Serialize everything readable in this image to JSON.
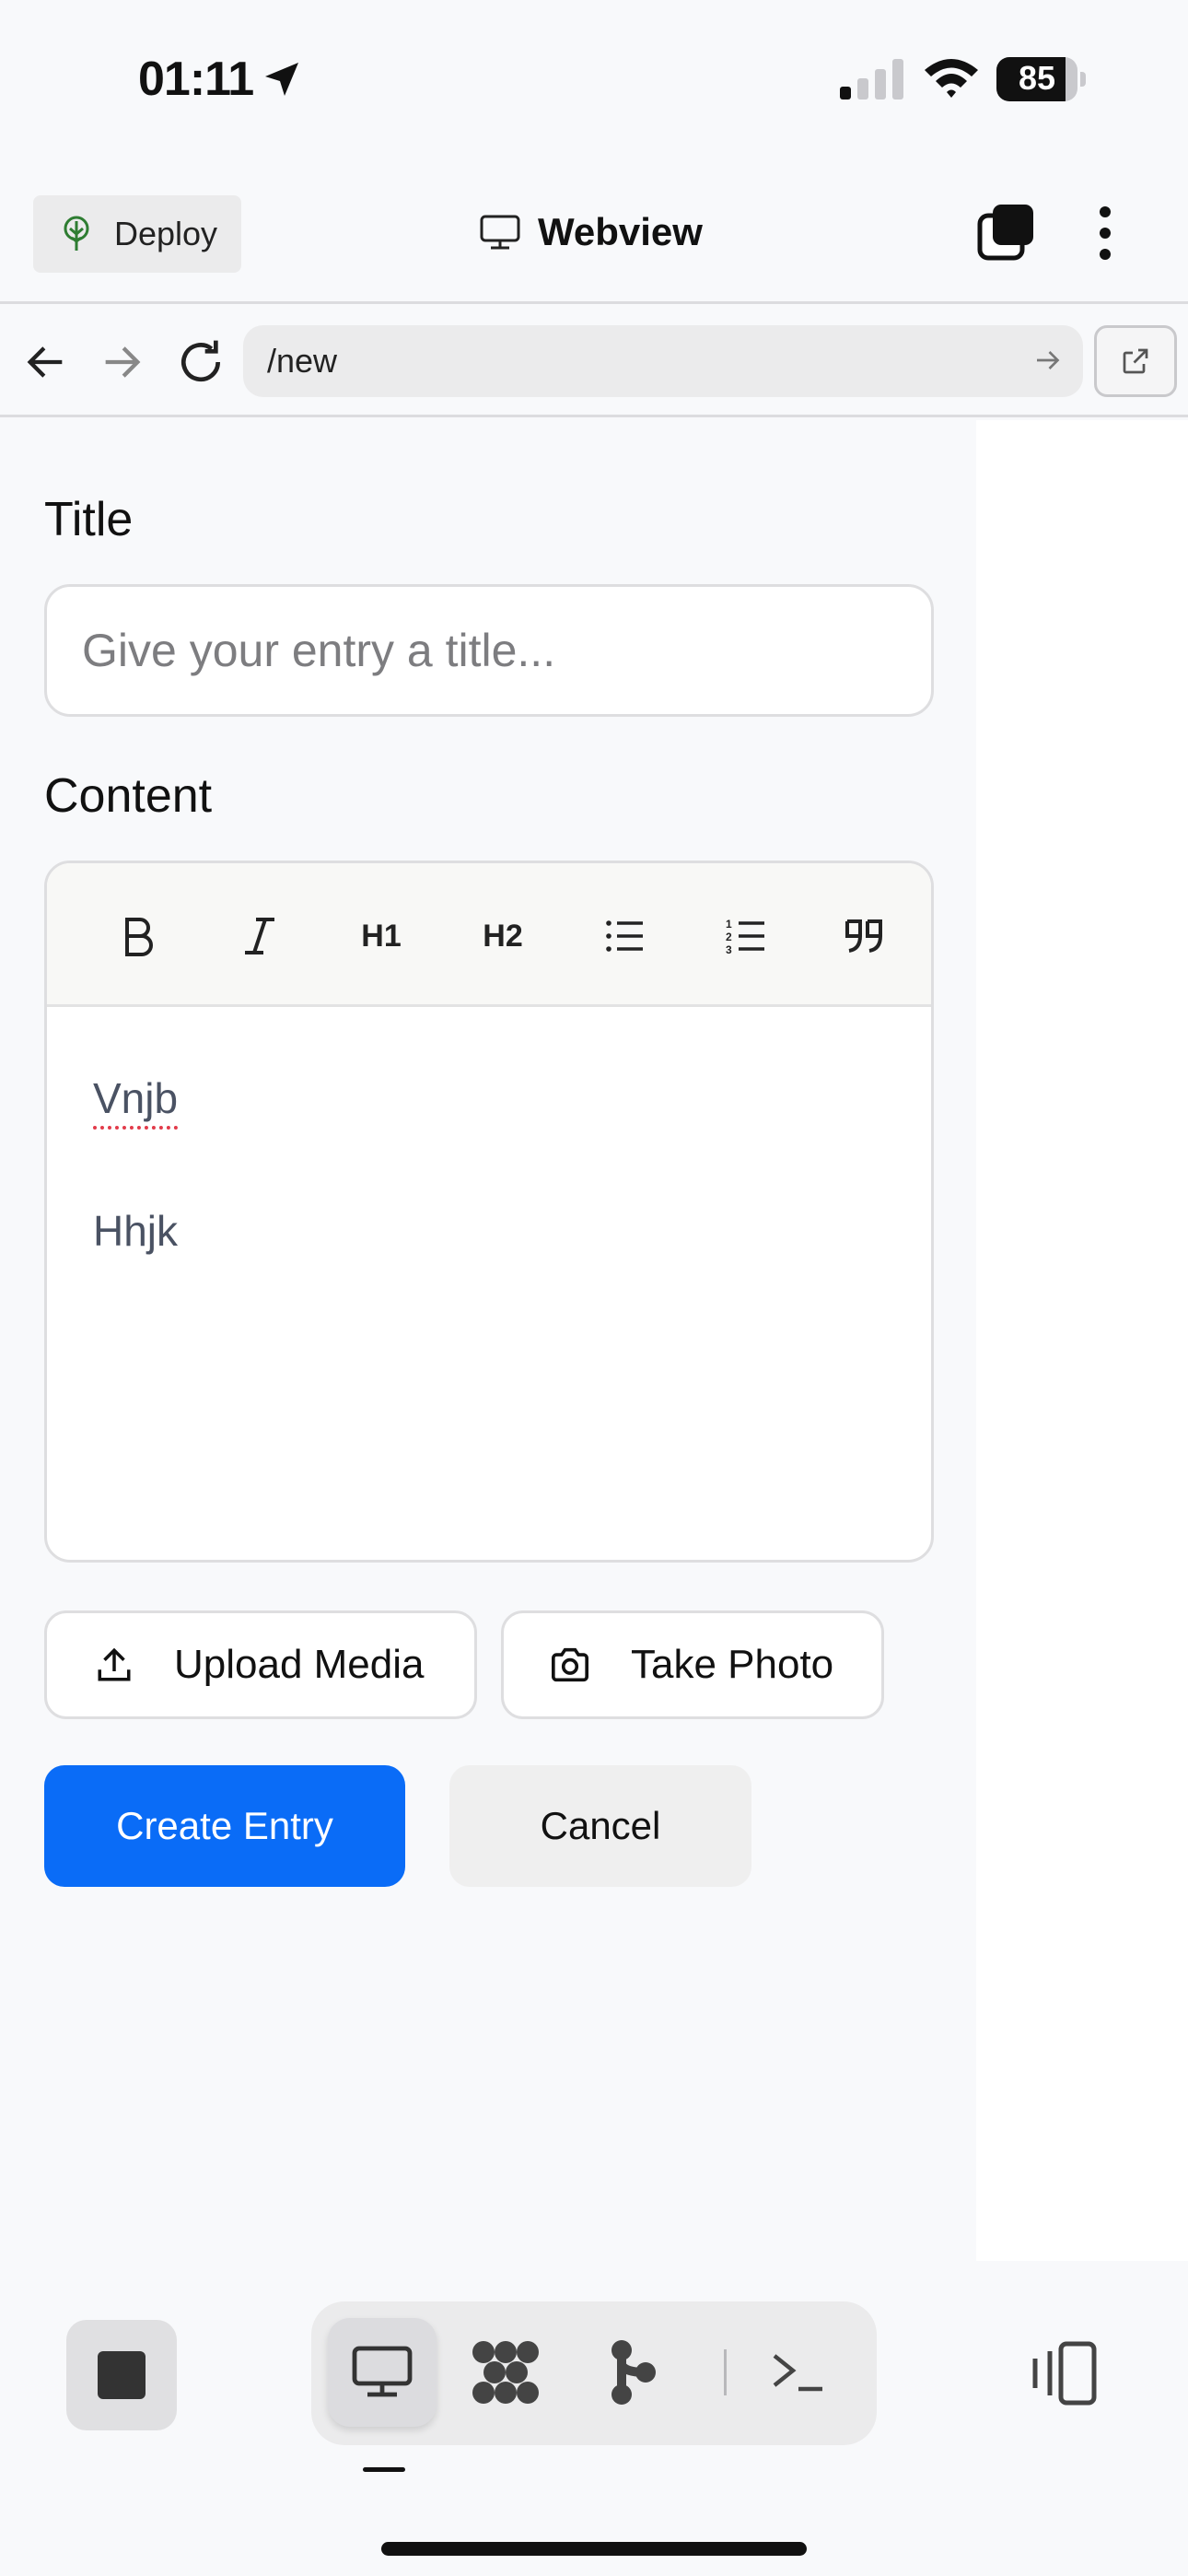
{
  "status_bar": {
    "time": "01:11",
    "battery": "85"
  },
  "header": {
    "deploy_label": "Deploy",
    "title": "Webview"
  },
  "url_bar": {
    "url": "/new"
  },
  "form": {
    "title_label": "Title",
    "title_placeholder": "Give your entry a title...",
    "content_label": "Content",
    "toolbar": {
      "bold": "B",
      "italic": "I",
      "h1": "H1",
      "h2": "H2"
    },
    "content_paragraphs": [
      "Vnjb",
      "Hhjk"
    ],
    "upload_label": "Upload Media",
    "photo_label": "Take Photo",
    "create_label": "Create Entry",
    "cancel_label": "Cancel"
  },
  "colors": {
    "primary": "#0a6cf7",
    "deploy_icon": "#2e7d32"
  },
  "icons": {
    "toolbar": [
      "bold-icon",
      "italic-icon",
      "heading-1-icon",
      "heading-2-icon",
      "bullet-list-icon",
      "numbered-list-icon",
      "quote-icon"
    ],
    "bottom_bar": [
      "stop-icon",
      "desktop-icon",
      "grid-icon",
      "branch-icon",
      "terminal-icon",
      "panel-icon"
    ]
  }
}
